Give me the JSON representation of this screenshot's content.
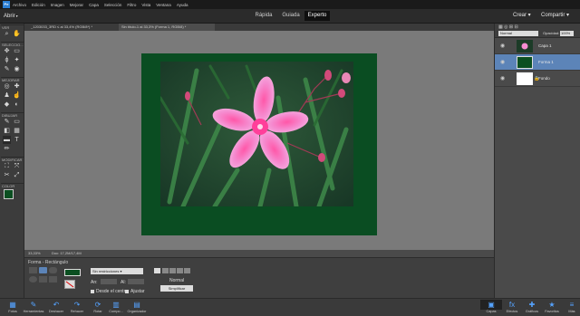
{
  "menubar": {
    "logo": "Pe",
    "items": [
      "Archivo",
      "Edición",
      "Imagen",
      "Mejorar",
      "Capa",
      "Selección",
      "Filtro",
      "Vista",
      "Ventana",
      "Ayuda"
    ]
  },
  "modebar": {
    "open_label": "Abrir",
    "tabs": [
      {
        "label": "Rápida",
        "active": false
      },
      {
        "label": "Guiada",
        "active": false
      },
      {
        "label": "Experto",
        "active": true
      }
    ],
    "create_label": "Crear",
    "share_label": "Compartir"
  },
  "toolbox": {
    "sections": [
      {
        "label": "VER",
        "icons": [
          "zoom-icon",
          "hand-icon"
        ],
        "glyphs": [
          "⌕",
          "✋"
        ]
      },
      {
        "label": "SELECCIO...",
        "icons": [
          "move-icon",
          "marquee-icon",
          "lasso-icon",
          "magic-wand-icon",
          "quick-select-icon",
          "eye-icon"
        ],
        "glyphs": [
          "✥",
          "▭",
          "ϕ",
          "✦",
          "✎",
          "◉"
        ]
      },
      {
        "label": "MEJORAR",
        "icons": [
          "red-eye-icon",
          "spot-heal-icon",
          "clone-stamp-icon",
          "smudge-icon",
          "sponge-icon",
          "dodge-icon"
        ],
        "glyphs": [
          "◎",
          "✚",
          "♟",
          "☝",
          "◆",
          "◐"
        ]
      },
      {
        "label": "DIBUJAR",
        "icons": [
          "brush-icon",
          "eraser-icon",
          "paint-bucket-icon",
          "gradient-icon",
          "shape-rectangle-icon",
          "text-icon",
          "pencil-icon"
        ],
        "glyphs": [
          "✎",
          "▭",
          "◧",
          "▦",
          "▬",
          "T",
          "✏"
        ]
      },
      {
        "label": "MODIFICAR",
        "icons": [
          "crop-icon",
          "recompose-icon",
          "content-move-icon",
          "straighten-icon"
        ],
        "glyphs": [
          "⛶",
          "⤧",
          "✂",
          "⤢"
        ]
      },
      {
        "label": "COLOR",
        "icons": [
          "swatch-icon"
        ],
        "glyphs": [
          ""
        ]
      }
    ],
    "foreground_color": "#0b4f21",
    "background_color": "#ffffff"
  },
  "doctabs": [
    {
      "label": "_1203033_3RD ≤ al 33,4% (RGB/8*) *",
      "active": false
    },
    {
      "label": "Sin título-1 al 33,3% (Forma 1, RGB/8) *",
      "active": true
    }
  ],
  "statusbar": {
    "zoom": "33,33%",
    "doc": "Doc: 17,2M/17,4M"
  },
  "options": {
    "tool_name": "Forma - Rectángulo",
    "constraint": "Sin restricciones",
    "w_label": "An:",
    "h_label": "Al:",
    "from_center_label": "Desde el centro",
    "snap_label": "Ajustar",
    "mode_label": "Normal",
    "simplify_label": "Simplificar",
    "shape_color": "#0b4f21"
  },
  "panel": {
    "blend_mode": "Normal",
    "opacity_label": "Opacidad:",
    "opacity_value": "100%",
    "layers": [
      {
        "name": "Capa 1",
        "active": false,
        "thumb": "photo"
      },
      {
        "name": "Forma 1",
        "active": true,
        "thumb": "green"
      },
      {
        "name": "Fondo",
        "active": false,
        "thumb": "white"
      }
    ]
  },
  "taskbar": {
    "left": [
      {
        "label": "Fotos",
        "icon": "photos-icon",
        "glyph": "▦"
      },
      {
        "label": "Herramientas",
        "icon": "tools-icon",
        "glyph": "✎"
      },
      {
        "label": "Deshacer",
        "icon": "undo-icon",
        "glyph": "↶"
      },
      {
        "label": "Rehacer",
        "icon": "redo-icon",
        "glyph": "↷"
      },
      {
        "label": "Rotar",
        "icon": "rotate-icon",
        "glyph": "⟳"
      },
      {
        "label": "Compo...",
        "icon": "layout-icon",
        "glyph": "▥"
      },
      {
        "label": "Organizador",
        "icon": "organizer-icon",
        "glyph": "▤"
      }
    ],
    "right": [
      {
        "label": "Capas",
        "icon": "layers-icon",
        "glyph": "▣"
      },
      {
        "label": "Efectos",
        "icon": "effects-icon",
        "glyph": "fx"
      },
      {
        "label": "Gráficos",
        "icon": "graphics-icon",
        "glyph": "✚"
      },
      {
        "label": "Favoritos",
        "icon": "favorites-icon",
        "glyph": "★"
      },
      {
        "label": "Más",
        "icon": "more-icon",
        "glyph": "≡"
      }
    ]
  }
}
